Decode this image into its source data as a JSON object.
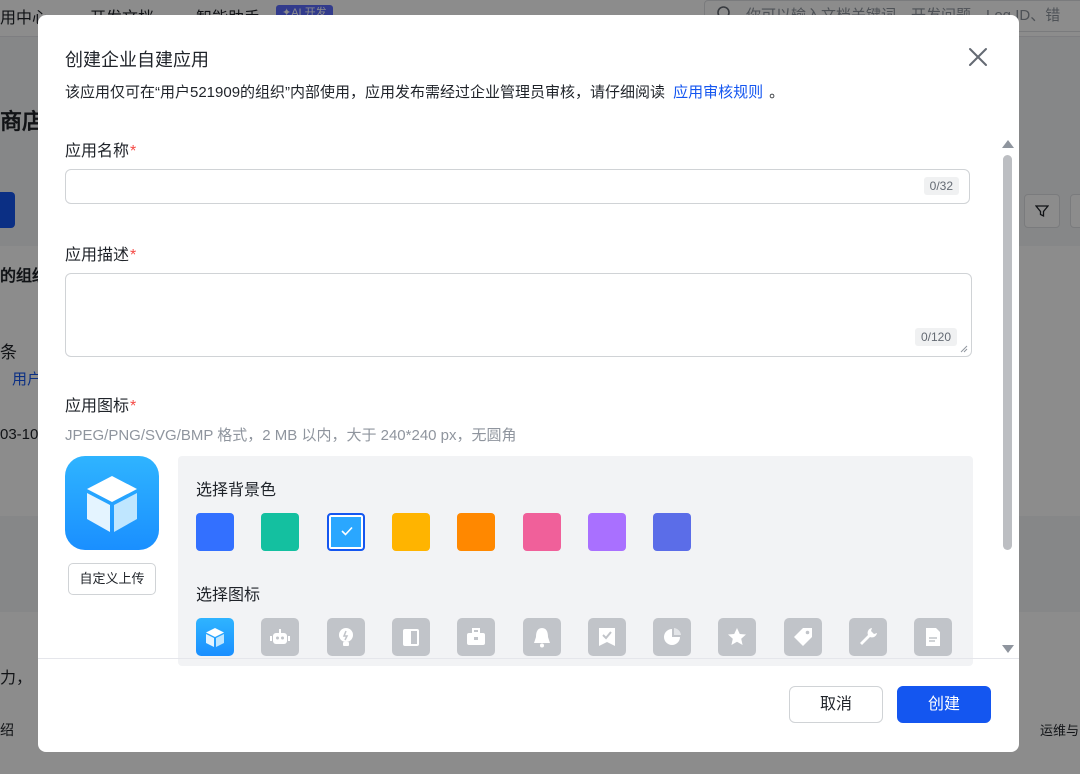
{
  "background": {
    "nav": [
      "用中心",
      "开发文档",
      "智能助手"
    ],
    "ai_badge": "✦AI 开发",
    "search_placeholder": "你可以输入文档关键词、开发问题、Log ID、错",
    "page_title": "商店",
    "org_label": "的组织",
    "row_label": "条",
    "row_link": "用户",
    "row_date": "03-10",
    "footer_text": "力，",
    "footer_text2": "绍",
    "footer_right": "运维与"
  },
  "dialog": {
    "title": "创建企业自建应用",
    "subtitle": "该应用仅可在“用户521909的组织”内部使用，应用发布需经过企业管理员审核，请仔细阅读",
    "rules_link": "应用审核规则",
    "subtitle_end": "。",
    "name_label": "应用名称",
    "name_counter": "0/32",
    "desc_label": "应用描述",
    "desc_counter": "0/120",
    "icon_label": "应用图标",
    "required_mark": "*",
    "icon_hint": "JPEG/PNG/SVG/BMP 格式，2 MB 以内，大于 240*240 px，无圆角",
    "upload_label": "自定义上传",
    "bg_color_label": "选择背景色",
    "icon_select_label": "选择图标",
    "cancel_label": "取消",
    "create_label": "创建"
  },
  "bg_colors": [
    "#3370ff",
    "#14c0a0",
    "#2aa7ff",
    "#ffb400",
    "#ff8800",
    "#f0609a",
    "#a970ff",
    "#5b6de8"
  ],
  "selected_bg_color_index": 2,
  "icons": [
    "cube-icon",
    "robot-icon",
    "lightbulb-icon",
    "door-icon",
    "briefcase-icon",
    "bell-icon",
    "badge-check-icon",
    "pie-chart-icon",
    "star-icon",
    "tag-icon",
    "wrench-icon",
    "document-icon"
  ],
  "selected_icon_index": 0
}
